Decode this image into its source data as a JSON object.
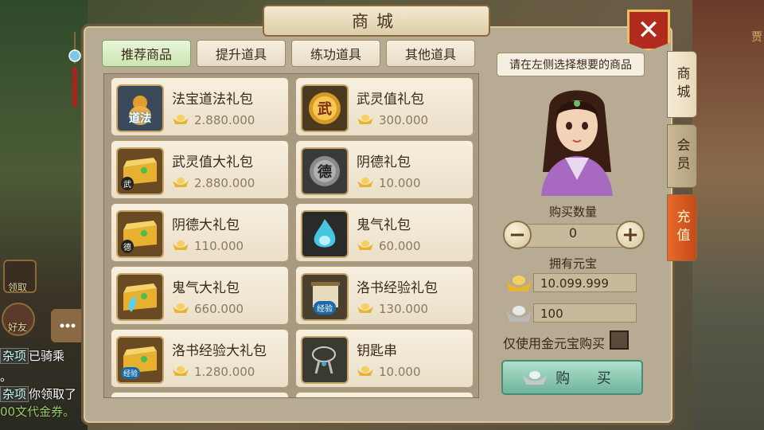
{
  "shop": {
    "title": "商城",
    "tabs": [
      {
        "label": "推荐商品",
        "active": true
      },
      {
        "label": "提升道具",
        "active": false
      },
      {
        "label": "练功道具",
        "active": false
      },
      {
        "label": "其他道具",
        "active": false
      }
    ],
    "items": [
      {
        "name": "法宝道法礼包",
        "price": "2.880.000",
        "icon": "daofa-gourd-icon",
        "icon_text": "道法"
      },
      {
        "name": "武灵值礼包",
        "price": "300.000",
        "icon": "wuling-orb-icon",
        "icon_text": "武"
      },
      {
        "name": "武灵值大礼包",
        "price": "2.880.000",
        "icon": "treasure-chest-icon",
        "icon_text": "武"
      },
      {
        "name": "阴德礼包",
        "price": "10.000",
        "icon": "yinde-orb-icon",
        "icon_text": "德"
      },
      {
        "name": "阴德大礼包",
        "price": "110.000",
        "icon": "treasure-chest-icon",
        "icon_text": "德"
      },
      {
        "name": "鬼气礼包",
        "price": "60.000",
        "icon": "ghost-flame-icon",
        "icon_text": ""
      },
      {
        "name": "鬼气大礼包",
        "price": "660.000",
        "icon": "treasure-chest-icon",
        "icon_text": ""
      },
      {
        "name": "洛书经验礼包",
        "price": "130.000",
        "icon": "scroll-icon",
        "icon_text": "经验"
      },
      {
        "name": "洛书经验大礼包",
        "price": "1.280.000",
        "icon": "treasure-chest-icon",
        "icon_text": "经验"
      },
      {
        "name": "钥匙串",
        "price": "10.000",
        "icon": "key-chain-icon",
        "icon_text": ""
      }
    ],
    "hint": "请在左侧选择想要的商品",
    "quantity_label": "购买数量",
    "quantity": "0",
    "own_label": "拥有元宝",
    "gold_balance": "10.099.999",
    "silver_balance": "100",
    "only_gold_label": "仅使用金元宝购买",
    "buy_label": "购 买",
    "side_tabs": [
      "商城",
      "会员",
      "充值"
    ]
  },
  "hud": {
    "claim_label": "领取",
    "friends_label": "好友",
    "chat": [
      {
        "tag": "杂项",
        "text": "已骑乘"
      },
      {
        "tag": "",
        "text": "。"
      },
      {
        "tag": "杂项",
        "text": "你领取了"
      },
      {
        "tag": "",
        "text": "00文代金券。"
      }
    ],
    "right_edge_text": "贾"
  },
  "colors": {
    "accent_gold": "#e8c060",
    "close_red": "#b02a1e",
    "buy_green": "#6fb49a"
  }
}
